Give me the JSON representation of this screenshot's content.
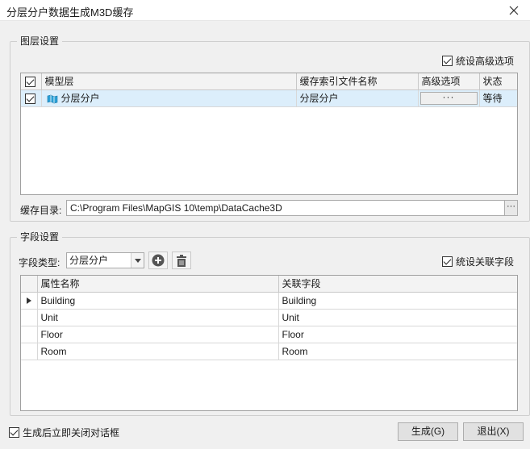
{
  "window": {
    "title": "分层分户数据生成M3D缓存"
  },
  "layer_group": {
    "title": "图层设置",
    "unify_advanced": {
      "label": "统设高级选项",
      "checked": true
    },
    "table": {
      "columns": [
        "模型层",
        "缓存索引文件名称",
        "高级选项",
        "状态"
      ],
      "rows": [
        {
          "checked": true,
          "layer": "分层分户",
          "index_name": "分层分户",
          "advanced": "···",
          "status": "等待"
        }
      ]
    },
    "cache_dir": {
      "label": "缓存目录:",
      "value": "C:\\Program Files\\MapGIS 10\\temp\\DataCache3D",
      "browse": "···"
    }
  },
  "field_group": {
    "title": "字段设置",
    "field_type": {
      "label": "字段类型:",
      "value": "分层分户"
    },
    "unify_link": {
      "label": "统设关联字段",
      "checked": true
    },
    "table": {
      "columns": [
        "属性名称",
        "关联字段"
      ],
      "rows": [
        {
          "name": "Building",
          "field": "Building"
        },
        {
          "name": "Unit",
          "field": "Unit"
        },
        {
          "name": "Floor",
          "field": "Floor"
        },
        {
          "name": "Room",
          "field": "Room"
        }
      ]
    }
  },
  "footer": {
    "close_after": {
      "label": "生成后立即关闭对话框",
      "checked": true
    },
    "generate": "生成(G)",
    "exit": "退出(X)"
  }
}
